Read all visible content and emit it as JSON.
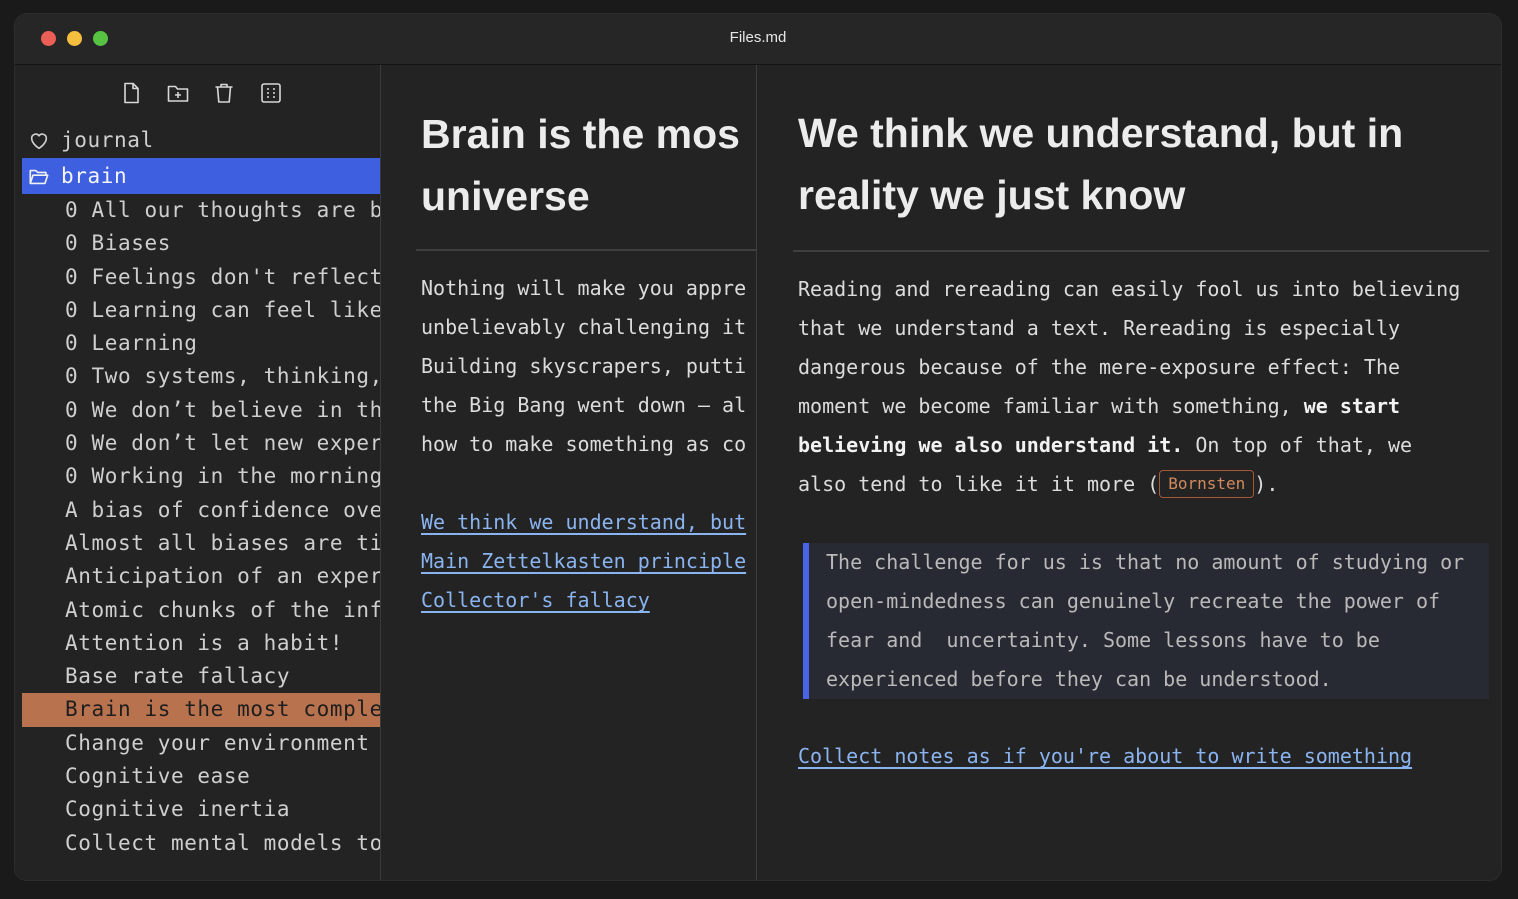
{
  "window": {
    "title": "Files.md"
  },
  "toolbar": {
    "icons": [
      "new-file-icon",
      "new-folder-icon",
      "trash-icon",
      "grid-icon"
    ]
  },
  "sidebar": {
    "folders": [
      {
        "label": "journal",
        "icon": "heart-icon"
      },
      {
        "label": "brain",
        "icon": "folder-open-icon",
        "selected": true
      }
    ],
    "files": [
      "0 All our thoughts are b",
      "0 Biases",
      "0 Feelings don't reflect",
      "0 Learning can feel like",
      "0 Learning",
      "0 Two systems, thinking,",
      "0 We don’t believe in the",
      "0 We don’t let new exper",
      "0 Working in the morning",
      "A bias of confidence ove",
      "Almost all biases are ti",
      "Anticipation of an exper",
      "Atomic chunks of the info",
      "Attention is a habit!",
      "Base rate fallacy",
      "Brain is the most comple",
      "Change your environment",
      "Cognitive ease",
      "Cognitive inertia",
      "Collect mental models to"
    ],
    "active_file_index": 15
  },
  "left_note": {
    "heading_lines": [
      "Brain is the mos",
      "universe"
    ],
    "paragraph_lines": [
      "Nothing will make you appre",
      "unbelievably challenging it",
      "Building skyscrapers, putti",
      "the Big Bang went down – al",
      "how to make something as co"
    ],
    "links": [
      "We think we understand, but",
      "Main Zettelkasten principle",
      "Collector's fallacy"
    ]
  },
  "right_note": {
    "heading_lines": [
      "We think we understand, but in",
      "reality we just know"
    ],
    "paragraph": {
      "line1": "Reading and rereading can easily fool us into believing",
      "line2": "that we understand a text. Rereading is especially",
      "line3": "dangerous because of the mere-exposure effect: The",
      "line4_pre": "moment we become familiar with something, ",
      "line4_bold": "we start",
      "line5_bold": "believing we also understand it.",
      "line5_post": " On top of that, we",
      "line6_pre": "also tend to like it it more (",
      "citation": "Bornsten",
      "line6_post": ")."
    },
    "quote_lines": [
      "The challenge for us is that no amount of studying or",
      "open-mindedness can genuinely recreate the power of",
      "fear and  uncertainty. Some lessons have to be",
      "experienced before they can be understood."
    ],
    "links": [
      "Collect notes as if you're about to write something"
    ]
  },
  "colors": {
    "background": "#232323",
    "selected_folder": "#3d5fe0",
    "active_file": "#b8724e",
    "link": "#8ab4f0",
    "quote_bar": "#4a64e6",
    "citation": "#d18a5e"
  }
}
